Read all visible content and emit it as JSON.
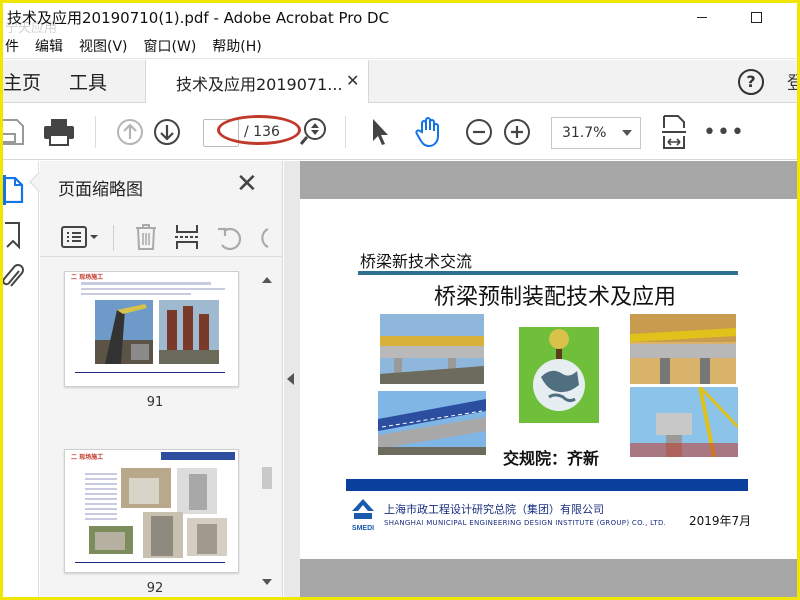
{
  "window": {
    "title": "技术及应用20190710(1).pdf - Adobe Acrobat Pro DC",
    "watermark": "宁天应用"
  },
  "menu": [
    "件",
    "编辑",
    "视图(V)",
    "窗口(W)",
    "帮助(H)"
  ],
  "tabs": {
    "home": "主页",
    "tools": "工具",
    "document": "技术及应用2019071...",
    "signin": "登"
  },
  "toolbar": {
    "page_total": "/ 136",
    "page_current": "",
    "zoom": "31.7%"
  },
  "panel": {
    "title": "页面缩略图",
    "thumbnails": [
      {
        "number": "91",
        "heading": "二 现场施工"
      },
      {
        "number": "92",
        "heading": "二 现场施工"
      }
    ]
  },
  "slide": {
    "subtitle": "桥梁新技术交流",
    "title": "桥梁预制装配技术及应用",
    "author": "交规院：齐新",
    "company_cn": "上海市政工程设计研究总院（集团）有限公司",
    "company_en": "SHANGHAI MUNICIPAL ENGINEERING DESIGN INSTITUTE (GROUP) CO., LTD.",
    "logo_text": "SMEDI",
    "date": "2019年7月"
  },
  "colors": {
    "accent_blue": "#1473e6",
    "annotation_red": "#c0392b",
    "slide_bar": "#0b3f9e",
    "slide_line": "#2e6f8e",
    "frame_yellow": "#f2e600"
  }
}
